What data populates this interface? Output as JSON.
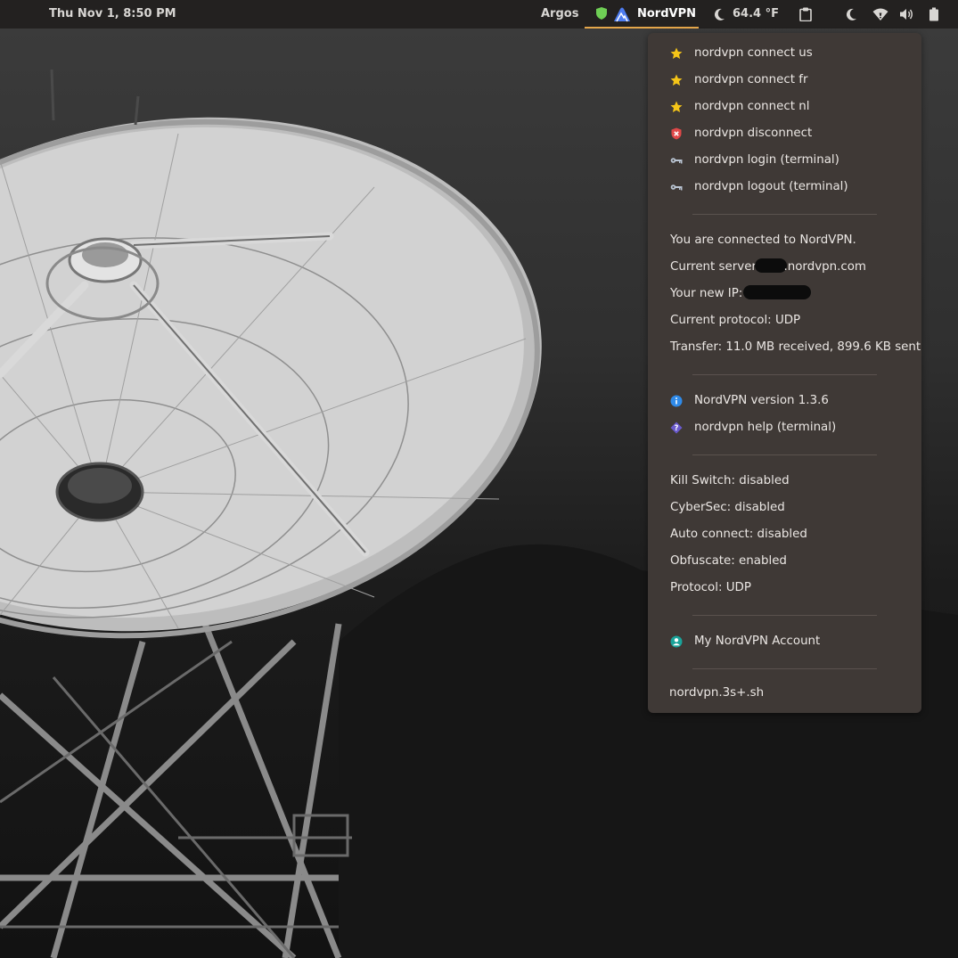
{
  "topbar": {
    "clock": "Thu Nov  1,  8:50 PM",
    "argos_label": "Argos",
    "nordvpn_label": "NordVPN",
    "temperature": "64.4 °F",
    "accent_color": "#e4a64a",
    "icons": [
      "shield-icon",
      "nordvpn-logo-icon",
      "moon-icon",
      "clipboard-icon",
      "night-light-icon",
      "wifi-icon",
      "volume-icon",
      "battery-icon"
    ]
  },
  "menu": {
    "connect_items": [
      {
        "label": "nordvpn connect us",
        "icon": "star-icon"
      },
      {
        "label": "nordvpn connect fr",
        "icon": "star-icon"
      },
      {
        "label": "nordvpn connect nl",
        "icon": "star-icon"
      },
      {
        "label": "nordvpn disconnect",
        "icon": "disconnect-icon"
      },
      {
        "label": "nordvpn login (terminal)",
        "icon": "key-icon"
      },
      {
        "label": "nordvpn logout (terminal)",
        "icon": "key-icon"
      }
    ],
    "status": {
      "connected": "You are connected to NordVPN.",
      "server_label": "Current server: ",
      "server_suffix": ".nordvpn.com",
      "ip_label": "Your new IP: ",
      "protocol": "Current protocol: UDP",
      "transfer": "Transfer: 11.0 MB received, 899.6 KB sent"
    },
    "info_items": [
      {
        "label": "NordVPN version 1.3.6",
        "icon": "info-icon"
      },
      {
        "label": "nordvpn help (terminal)",
        "icon": "help-icon"
      }
    ],
    "settings": {
      "kill_switch": "Kill Switch: disabled",
      "cybersec": "CyberSec: disabled",
      "auto_connect": "Auto connect: disabled",
      "obfuscate": "Obfuscate: enabled",
      "protocol": "Protocol: UDP"
    },
    "account": {
      "label": "My NordVPN Account",
      "icon": "account-icon"
    },
    "script_name": "nordvpn.3s+.sh"
  }
}
